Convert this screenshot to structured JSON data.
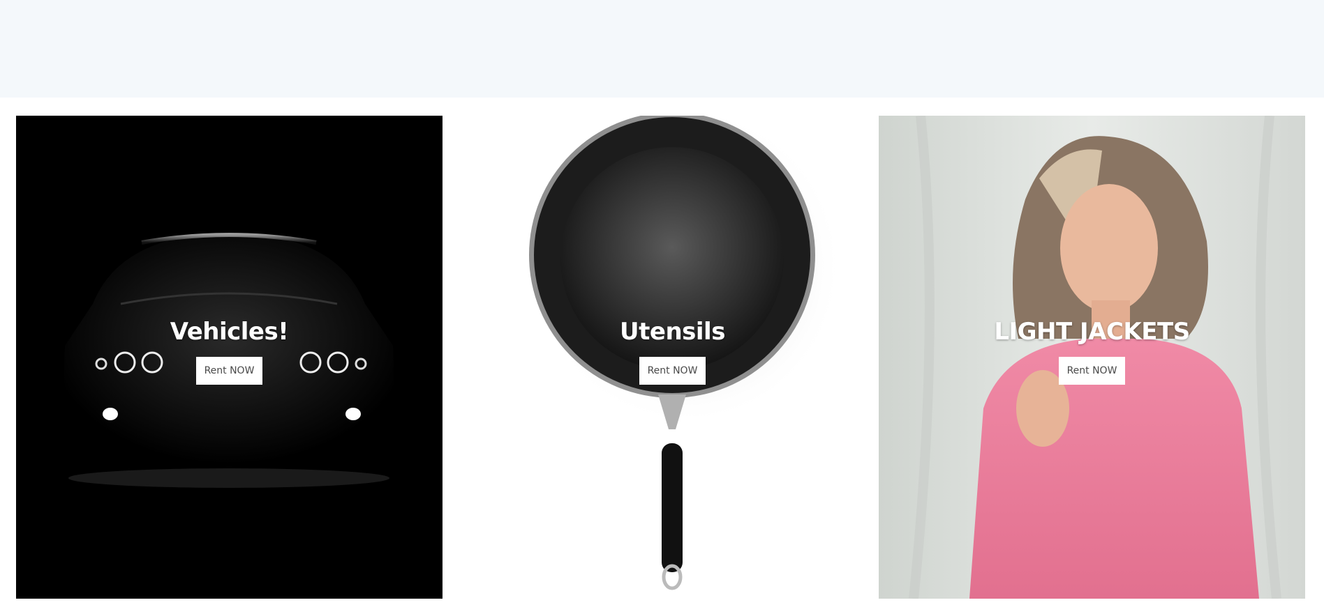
{
  "cards": [
    {
      "title": "Vehicles!",
      "button_label": "Rent NOW",
      "image": "car-headlights-image"
    },
    {
      "title": "Utensils",
      "button_label": "Rent NOW",
      "image": "frying-pan-image"
    },
    {
      "title": "LIGHT JACKETS",
      "button_label": "Rent NOW",
      "image": "woman-pink-jacket-image"
    }
  ],
  "colors": {
    "header_band": "#f4f8fb",
    "button_bg": "#ffffff",
    "button_text": "#4a4a4a",
    "title_text": "#ffffff"
  }
}
